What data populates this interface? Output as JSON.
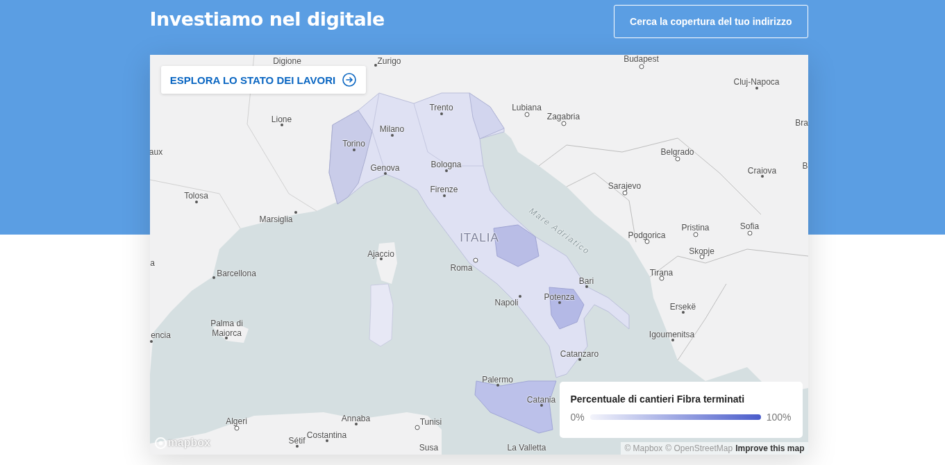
{
  "header": {
    "title": "Investiamo nel digitale",
    "button": "Cerca la copertura del tuo indirizzo"
  },
  "map": {
    "explore_button": "ESPLORA LO STATO DEI LAVORI",
    "labels": [
      {
        "text": "Digione",
        "kind": "place"
      },
      {
        "text": "Zurigo",
        "kind": "city"
      },
      {
        "text": "Budapest",
        "kind": "capital"
      },
      {
        "text": "Cluj-Napoca",
        "kind": "city"
      },
      {
        "text": "Lubiana",
        "kind": "capital"
      },
      {
        "text": "Zagabria",
        "kind": "capital"
      },
      {
        "text": "Trento",
        "kind": "city"
      },
      {
        "text": "Milano",
        "kind": "city"
      },
      {
        "text": "Lione",
        "kind": "city"
      },
      {
        "text": "Torino",
        "kind": "city"
      },
      {
        "text": "aux",
        "kind": "place"
      },
      {
        "text": "Belgrado",
        "kind": "capital"
      },
      {
        "text": "Genova",
        "kind": "city"
      },
      {
        "text": "Bologna",
        "kind": "city"
      },
      {
        "text": "Bra",
        "kind": "place"
      },
      {
        "text": "Craiova",
        "kind": "city"
      },
      {
        "text": "B",
        "kind": "place"
      },
      {
        "text": "Firenze",
        "kind": "city"
      },
      {
        "text": "Sarajevo",
        "kind": "capital"
      },
      {
        "text": "Tolosa",
        "kind": "city"
      },
      {
        "text": "Marsiglia",
        "kind": "city"
      },
      {
        "text": "Mare Adriatico",
        "kind": "sea"
      },
      {
        "text": "Pristina",
        "kind": "capital"
      },
      {
        "text": "Sofia",
        "kind": "capital"
      },
      {
        "text": "Podgorica",
        "kind": "capital"
      },
      {
        "text": "Skopje",
        "kind": "capital"
      },
      {
        "text": "ITALIA",
        "kind": "country"
      },
      {
        "text": "Ajaccio",
        "kind": "city"
      },
      {
        "text": "a",
        "kind": "place"
      },
      {
        "text": "Roma",
        "kind": "capital"
      },
      {
        "text": "Barcellona",
        "kind": "city"
      },
      {
        "text": "Tirana",
        "kind": "capital"
      },
      {
        "text": "Bari",
        "kind": "city"
      },
      {
        "text": "Napoli",
        "kind": "city"
      },
      {
        "text": "Potenza",
        "kind": "city"
      },
      {
        "text": "Ersekë",
        "kind": "city"
      },
      {
        "text": "encia",
        "kind": "city"
      },
      {
        "text": "Palma di Maiorca",
        "kind": "city"
      },
      {
        "text": "Igoumenitsa",
        "kind": "city"
      },
      {
        "text": "Catanzaro",
        "kind": "city"
      },
      {
        "text": "Palermo",
        "kind": "city"
      },
      {
        "text": "Catania",
        "kind": "city"
      },
      {
        "text": "Algeri",
        "kind": "capital"
      },
      {
        "text": "Annaba",
        "kind": "city"
      },
      {
        "text": "Tunisi",
        "kind": "capital"
      },
      {
        "text": "Sétif",
        "kind": "city"
      },
      {
        "text": "Costantina",
        "kind": "city"
      },
      {
        "text": "La Valletta",
        "kind": "place"
      },
      {
        "text": "Susa",
        "kind": "place"
      }
    ],
    "logo": "mapbox",
    "attribution": [
      {
        "text": "© Mapbox",
        "kind": "plain"
      },
      {
        "text": "© OpenStreetMap",
        "kind": "plain"
      },
      {
        "text": "Improve this map",
        "kind": "bold"
      }
    ],
    "legend": {
      "title": "Percentuale di cantieri Fibra terminati",
      "min": "0%",
      "max": "100%"
    }
  }
}
